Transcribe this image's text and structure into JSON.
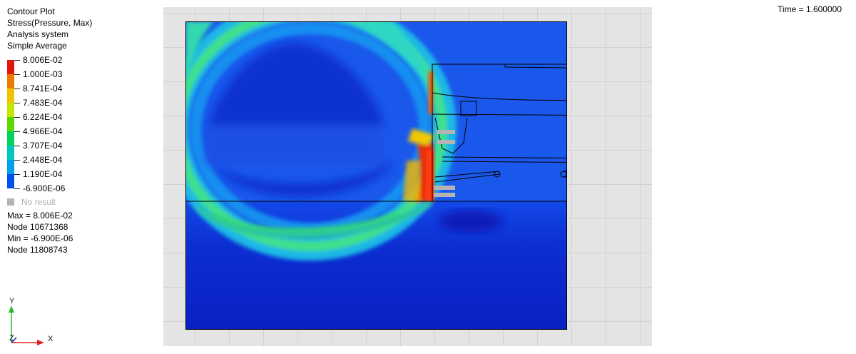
{
  "legend": {
    "title": "Contour Plot",
    "subtitle": "Stress(Pressure, Max)",
    "system": "Analysis system",
    "averaging": "Simple Average",
    "levels": [
      "8.006E-02",
      "1.000E-03",
      "8.741E-04",
      "7.483E-04",
      "6.224E-04",
      "4.966E-04",
      "3.707E-04",
      "2.448E-04",
      "1.190E-04",
      "-6.900E-06"
    ],
    "colors": [
      "#e0160a",
      "#ef7a00",
      "#f2c300",
      "#c4e600",
      "#5ad800",
      "#00d35c",
      "#00c8c0",
      "#00a0ea",
      "#0050f0"
    ],
    "no_result_label": "No result",
    "no_result_color": "#b4b4b4"
  },
  "stats": {
    "max_line": "Max = 8.006E-02",
    "max_node": "Node 10671368",
    "min_line": "Min = -6.900E-06",
    "min_node": "Node 11808743"
  },
  "time_label": "Time = 1.600000",
  "triad": {
    "y_label": "Y",
    "z_label": "Z",
    "x_label": "X"
  },
  "palette": {
    "background_grid": "#e4e4e4",
    "deep_blue": "#0a1fc8",
    "mid_blue": "#1a5ef0",
    "cyan": "#20c8d8",
    "green": "#3ee07a",
    "red": "#ff3010"
  }
}
